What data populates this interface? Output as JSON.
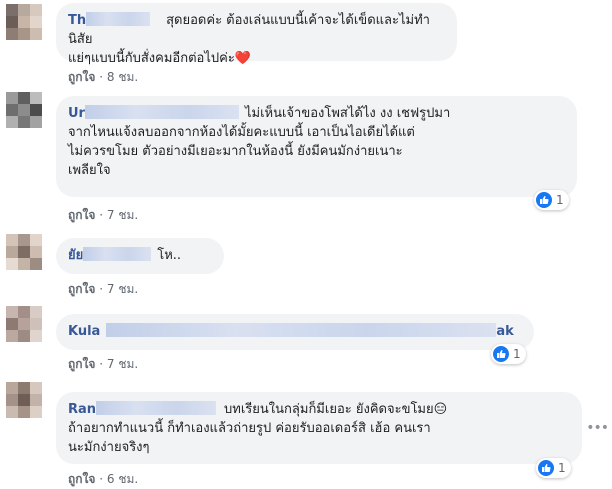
{
  "comments": [
    {
      "author_visible": "Th",
      "author_suffix": "",
      "lines": [
        "สุดยอดค่ะ ต้องเล่นแบบนี้เค้าจะได้เข็ดและไม่ทำนิสัย",
        "แย่ๆแบบนี้กับสั่งคมอีกต่อไปค่ะ❤️"
      ],
      "like_label": "ถูกใจ",
      "time": "8 ชม.",
      "reactions": ""
    },
    {
      "author_visible": "Ur",
      "author_suffix": "",
      "lines": [
        "ไม่เห็นเจ้าของโพสได้ไง งง เชฟรูปมา",
        "จากไหนแจ้งลบออกจากห้องได้มั้ยคะแบบนี้ เอาเป็นไอเดียได้แต่",
        "ไม่ควรขโมย ตัวอย่างมีเยอะมากในห้องนี้ ยังมีคนมักง่ายเนาะ",
        "เพลียใจ"
      ],
      "like_label": "ถูกใจ",
      "time": "7 ชม.",
      "reactions": "1"
    },
    {
      "author_visible": "ยัย",
      "author_suffix": "",
      "lines": [
        "โห.."
      ],
      "like_label": "ถูกใจ",
      "time": "7 ชม.",
      "reactions": ""
    },
    {
      "author_visible": "Kula",
      "author_suffix": "ak",
      "lines": [],
      "like_label": "ถูกใจ",
      "time": "7 ชม.",
      "reactions": "1"
    },
    {
      "author_visible": "Ran",
      "author_suffix": "",
      "lines": [
        "บทเรียนในกลุ่มก็มีเยอะ ยังคิดจะขโมย😑",
        "ถ้าอยากทำแนวนี้ ก็ทำเองแล้วถ่ายรูป ค่อยรับออเดอร์สิ เฮ้อ คนเรา",
        "นะมักง่ายจริงๆ"
      ],
      "like_label": "ถูกใจ",
      "time": "6 ชม.",
      "reactions": "1"
    }
  ],
  "separator": "·",
  "icons": {
    "reaction": "like-thumb-icon",
    "more": "more-options-icon"
  },
  "colors": {
    "author": "#385898",
    "bubble": "#f2f3f5",
    "like_blue": "#1877f2"
  }
}
